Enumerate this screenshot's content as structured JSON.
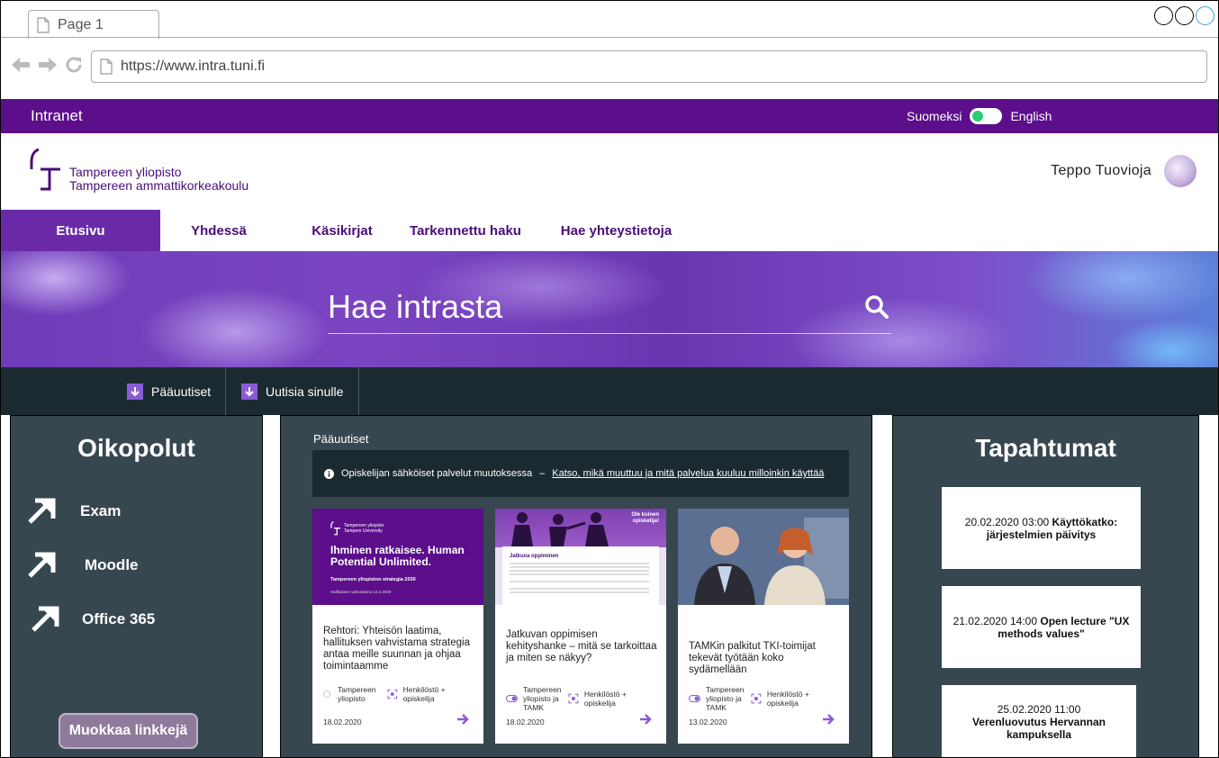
{
  "browser": {
    "tab_title": "Page 1",
    "url": "https://www.intra.tuni.fi"
  },
  "topbar": {
    "brand": "Intranet",
    "lang_fi": "Suomeksi",
    "lang_en": "English"
  },
  "header": {
    "logo_line1": "Tampereen yliopisto",
    "logo_line2": "Tampereen ammattikorkeakoulu",
    "user_name": "Teppo Tuovioja"
  },
  "nav": {
    "items": [
      "Etusivu",
      "Yhdessä",
      "Käsikirjat",
      "Tarkennettu haku",
      "Hae yhteystietoja"
    ]
  },
  "hero": {
    "search_placeholder": "Hae intrasta"
  },
  "news_tabs": [
    "Pääuutiset",
    "Uutisia sinulle"
  ],
  "shortcuts": {
    "title": "Oikopolut",
    "items": [
      "Exam",
      "Moodle",
      "Office 365"
    ],
    "edit_label": "Muokkaa linkkejä"
  },
  "news": {
    "section_label": "Pääuutiset",
    "notice_text": "Opiskelijan sähköiset palvelut muutoksessa",
    "notice_sep": "–",
    "notice_link": "Katso, mikä muuttuu ja mitä palvelua kuuluu milloinkin käyttää",
    "cards": [
      {
        "img_logo": "Tampereen yliopisto Tampere University",
        "img_headline": "Ihminen ratkaisee. Human Potential Unlimited.",
        "img_sub": "Tampereen yliopiston strategia 2030",
        "img_small": "Hallituksen vahvistama 13.2.2020",
        "title": "Rehtori: Yhteisön laatima, hallituksen vahvistama strategia antaa meille suunnan ja ohjaa toimintaamme",
        "org": "Tampereen yliopisto",
        "audience": "Henkilöstö + opiskelija",
        "date": "18.02.2020"
      },
      {
        "img_badge": "Ole kuinen opiskelija!",
        "img_headline": "Jatkuva oppiminen",
        "title": "Jatkuvan oppimisen kehityshanke – mitä se tarkoittaa ja miten se näkyy?",
        "org": "Tampereen yliopisto ja TAMK",
        "audience": "Henkilöstö + opiskelija",
        "date": "18.02.2020"
      },
      {
        "title": "TAMKin palkitut TKI-toimijat tekevät työtään koko sydämellään",
        "org": "Tampereen yliopisto ja TAMK",
        "audience": "Henkilöstö + opiskelija",
        "date": "13.02.2020"
      }
    ]
  },
  "events": {
    "title": "Tapahtumat",
    "items": [
      {
        "time": "20.02.2020 03:00",
        "name": "Käyttökatko: järjestelmien päivitys"
      },
      {
        "time": "21.02.2020 14:00",
        "name": "Open lecture \"UX methods values\""
      },
      {
        "time": "25.02.2020 11:00",
        "name": "Verenluovutus Hervannan kampuksella"
      }
    ]
  },
  "colors": {
    "brand_purple": "#5c0e8b",
    "accent_purple": "#8b5bd6",
    "panel_bg": "#37474f",
    "dark_strip": "#1b2a30"
  }
}
